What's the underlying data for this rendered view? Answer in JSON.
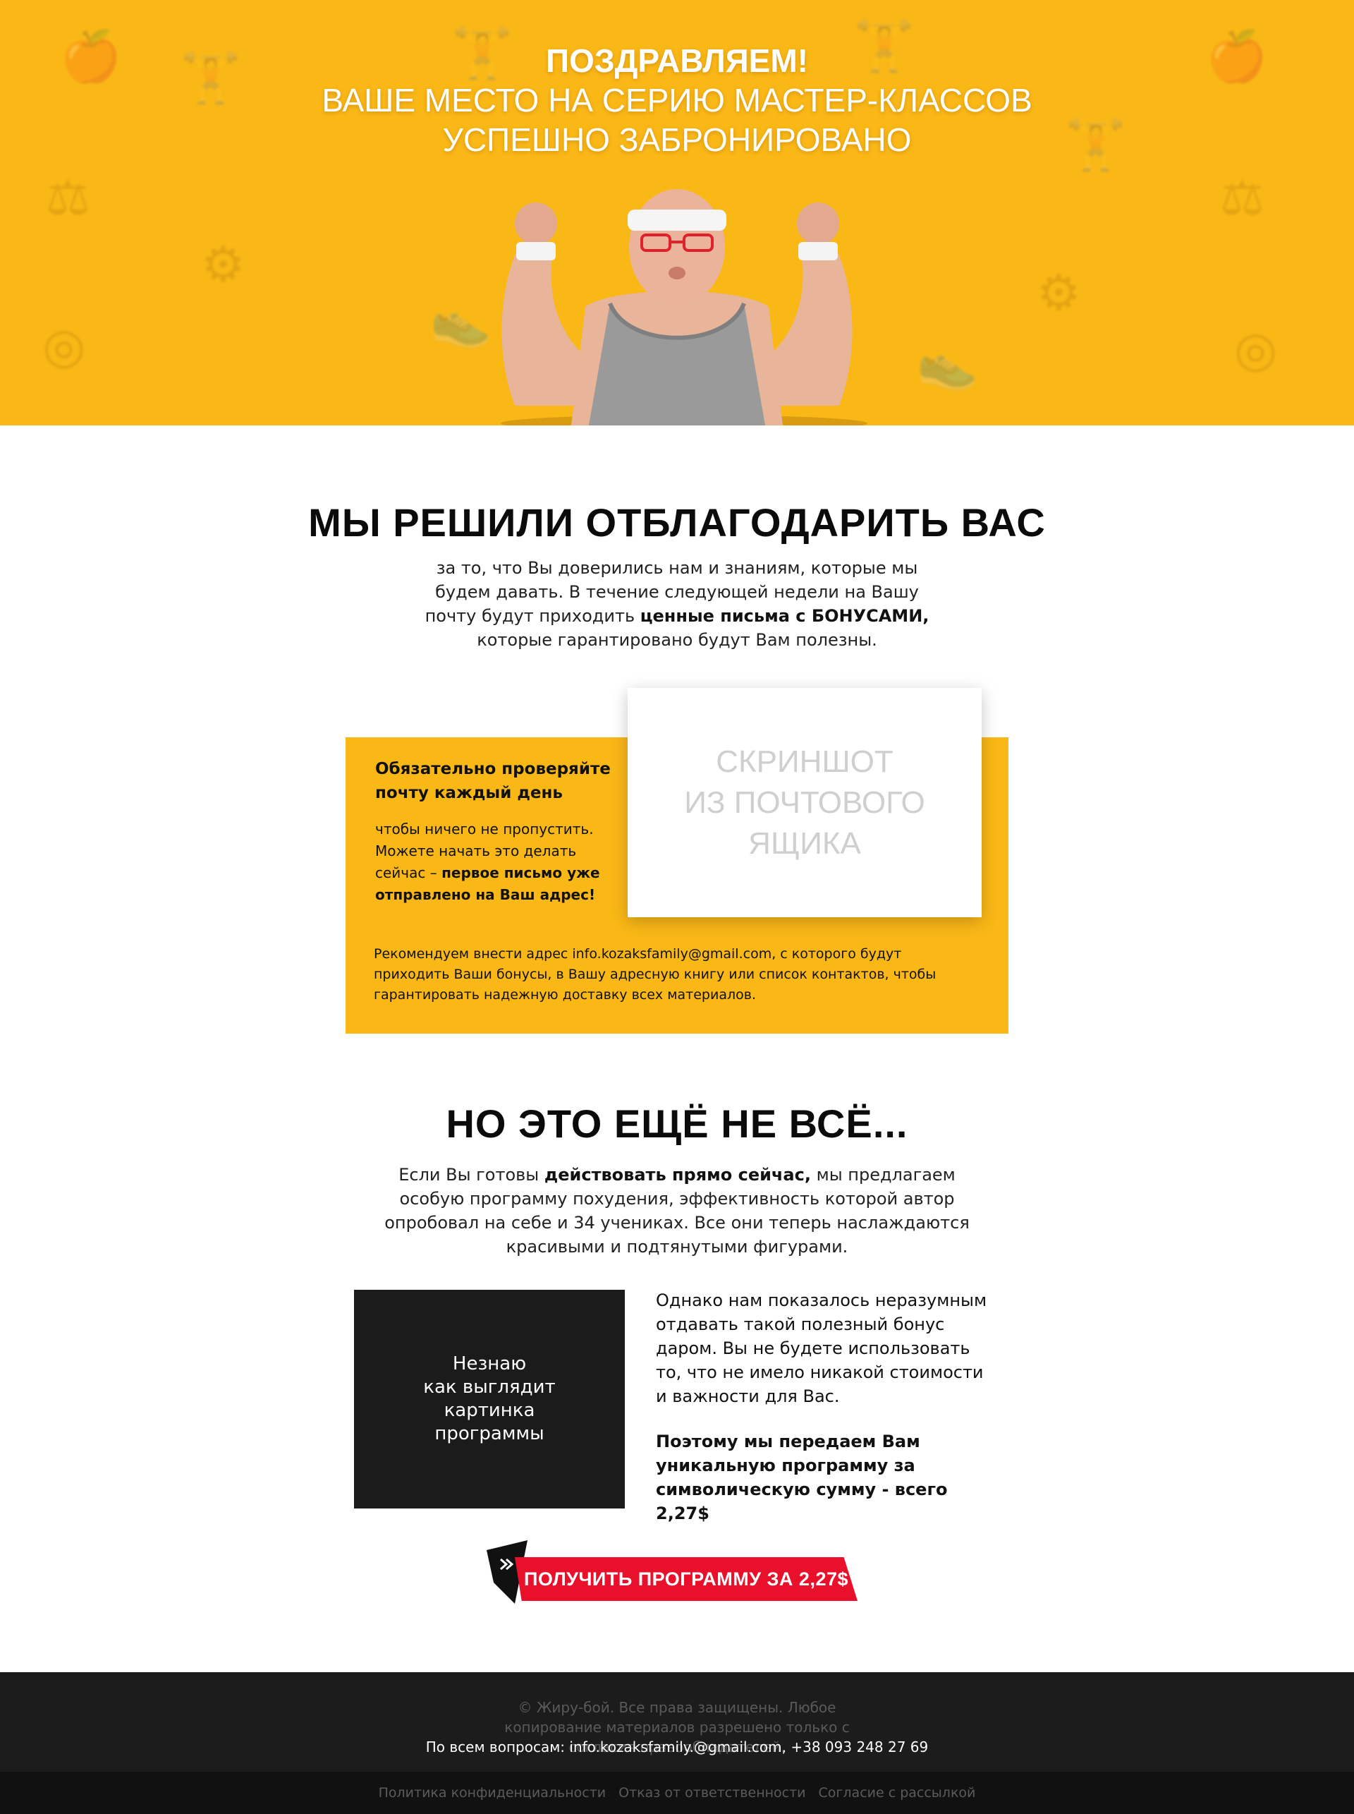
{
  "hero": {
    "line1": "Поздравляем!",
    "line2": "Ваше место на серию мастер-классов",
    "line3": "успешно забронировано"
  },
  "thanks": {
    "title": "Мы решили отблагодарить вас",
    "text_a": "за то, что Вы доверились нам и знаниям, которые мы будем давать. В течение следующей недели на Вашу почту будут приходить ",
    "text_bold": "ценные письма с БОНУСАМИ,",
    "text_b": " которые гарантировано будут Вам полезны."
  },
  "mailbox": {
    "title": "Обязательно проверяйте почту каждый день",
    "text": "чтобы ничего не пропустить. Можете начать это делать сейчас – ",
    "text_bold": "первое письмо уже отправлено на Ваш адрес!",
    "note": "Рекомендуем внести адрес info.kozaksfamily@gmail.com, с которого будут приходить Ваши бонусы, в Вашу адресную книгу или список контактов, чтобы гарантировать надежную доставку всех материалов.",
    "screenshot_placeholder": "Скриншот\nиз почтового\nящика"
  },
  "offer": {
    "title": "Но это ещё не всё...",
    "text_a": "Если Вы готовы ",
    "text_bold": "действовать прямо сейчас,",
    "text_b": " мы предлагаем особую программу похудения, эффективность которой автор опробовал на себе и 34 учениках. Все они теперь наслаждаются красивыми и подтянутыми фигурами.",
    "image_placeholder": "Незнаю\nкак выглядит\nкартинка\nпрограммы",
    "side_text": "Однако нам показалось неразумным отдавать такой полезный бонус даром. Вы не будете использовать то, что не имело никакой стоимости и важности для Вас.",
    "side_bold": "Поэтому мы передаем Вам уникальную программу за символическую сумму - всего 2,27$",
    "cta_label": "Получить программу за 2,27$"
  },
  "footer": {
    "copyright": "© Жиру-бой. Все права защищены. Любое копирование материалов разрешено только с согласия правообладателей.",
    "contacts": "По всем вопросам: info.kozaksfamily.@gmail.com, +38 093 248 27 69",
    "links": [
      "Политика конфиденциальности",
      "Отказ от ответственности",
      "Согласие с рассылкой"
    ]
  },
  "colors": {
    "yellow": "#fab817",
    "red": "#e8102a",
    "dark": "#1c1c1c"
  },
  "icons": [
    "apple-icon",
    "dumbbell-icon",
    "kettlebell-icon",
    "sneaker-icon",
    "scale-icon",
    "tape-measure-icon",
    "chevrons-right-icon"
  ]
}
